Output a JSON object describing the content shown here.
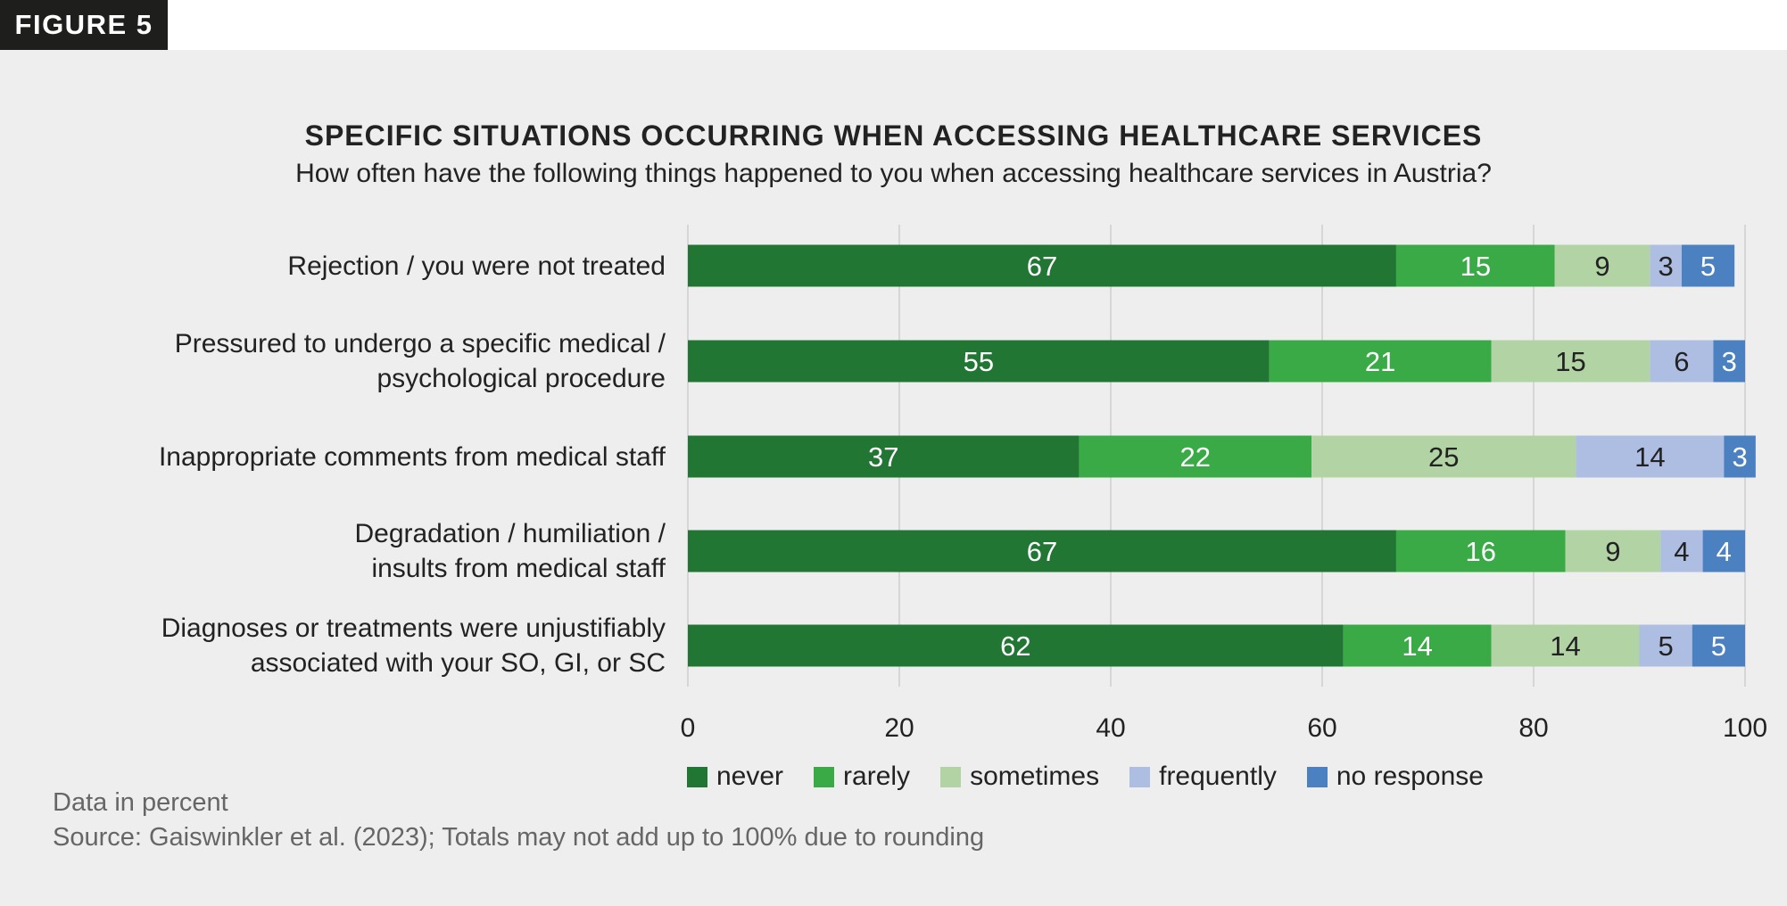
{
  "figure_tag": "FIGURE 5",
  "title": "SPECIFIC SITUATIONS OCCURRING WHEN ACCESSING HEALTHCARE SERVICES",
  "subtitle": "How often have the following things happened to you when accessing healthcare services in Austria?",
  "notes": {
    "unit": "Data in percent",
    "source": "Source: Gaiswinkler et al. (2023); Totals may not add up to 100% due to rounding"
  },
  "chart_data": {
    "type": "bar",
    "orientation": "horizontal",
    "stacked": true,
    "title": "SPECIFIC SITUATIONS OCCURRING WHEN ACCESSING HEALTHCARE SERVICES",
    "subtitle": "How often have the following things happened to you when accessing healthcare services in Austria?",
    "xlabel": "",
    "ylabel": "",
    "xlim": [
      0,
      100
    ],
    "xticks": [
      "0",
      "20",
      "40",
      "60",
      "80",
      "100"
    ],
    "grid": true,
    "legend_position": "bottom",
    "categories": [
      "Rejection / you were not treated",
      "Pressured to undergo a specific medical /\npsychological procedure",
      "Inappropriate comments from medical staff",
      "Degradation / humiliation /\ninsults from medical staff",
      "Diagnoses or treatments were unjustifiably\nassociated with your SO, GI, or SC"
    ],
    "series": [
      {
        "name": "never",
        "color": "#217634",
        "label_color": "#ffffff",
        "values": [
          67,
          55,
          37,
          67,
          62
        ]
      },
      {
        "name": "rarely",
        "color": "#3aaa47",
        "label_color": "#ffffff",
        "values": [
          15,
          21,
          22,
          16,
          14
        ]
      },
      {
        "name": "sometimes",
        "color": "#b2d4a4",
        "label_color": "#222222",
        "values": [
          9,
          15,
          25,
          9,
          14
        ]
      },
      {
        "name": "frequently",
        "color": "#aebde2",
        "label_color": "#222222",
        "values": [
          3,
          6,
          14,
          4,
          5
        ]
      },
      {
        "name": "no response",
        "color": "#4b80c1",
        "label_color": "#ffffff",
        "values": [
          5,
          3,
          3,
          4,
          5
        ]
      }
    ]
  }
}
